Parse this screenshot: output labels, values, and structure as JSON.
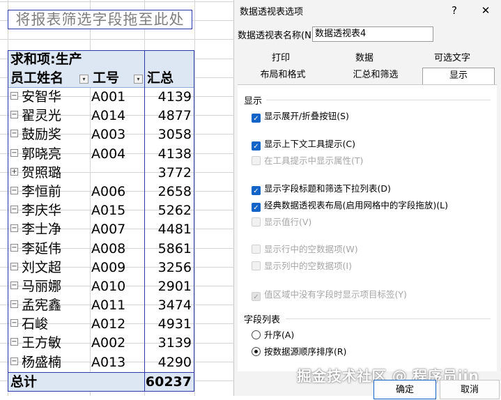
{
  "sheet": {
    "drop_hint": "将报表筛选字段拖至此处",
    "pivot": {
      "title": "求和项:生产",
      "header_name": "员工姓名",
      "header_id": "工号",
      "header_sum": "汇总",
      "filter_glyph": "▾",
      "expand_glyph": "⊞",
      "collapse_glyph": "⊟",
      "rows": [
        {
          "name": "安智华",
          "id": "A001",
          "value": "4139",
          "toggle": "−"
        },
        {
          "name": "翟灵光",
          "id": "A014",
          "value": "4877",
          "toggle": "−"
        },
        {
          "name": "鼓励奖",
          "id": "A003",
          "value": "3058",
          "toggle": "−"
        },
        {
          "name": "郭晓亮",
          "id": "A004",
          "value": "4138",
          "toggle": "−"
        },
        {
          "name": "贺照璐",
          "id": "",
          "value": "3772",
          "toggle": "+"
        },
        {
          "name": "李恒前",
          "id": "A006",
          "value": "2658",
          "toggle": "−"
        },
        {
          "name": "李庆华",
          "id": "A015",
          "value": "5262",
          "toggle": "−"
        },
        {
          "name": "李士净",
          "id": "A007",
          "value": "4481",
          "toggle": "−"
        },
        {
          "name": "李延伟",
          "id": "A008",
          "value": "5861",
          "toggle": "−"
        },
        {
          "name": "刘文超",
          "id": "A009",
          "value": "3256",
          "toggle": "−"
        },
        {
          "name": "马丽娜",
          "id": "A010",
          "value": "2901",
          "toggle": "−"
        },
        {
          "name": "孟宪鑫",
          "id": "A011",
          "value": "3474",
          "toggle": "−"
        },
        {
          "name": "石峻",
          "id": "A012",
          "value": "4931",
          "toggle": "−"
        },
        {
          "name": "王方敏",
          "id": "A002",
          "value": "3139",
          "toggle": "−"
        },
        {
          "name": "杨盛楠",
          "id": "A013",
          "value": "4290",
          "toggle": "−"
        }
      ],
      "total_label": "总计",
      "total_value": "60237"
    }
  },
  "dialog": {
    "title": "数据透视表选项",
    "help": "?",
    "close": "✕",
    "name_label": "数据透视表名称(N):",
    "name_value": "数据透视表4",
    "tabs_row1": [
      "打印",
      "数据",
      "可选文字"
    ],
    "tabs_row2": [
      "布局和格式",
      "汇总和筛选",
      "显示"
    ],
    "active_tab": "显示",
    "section_display": "显示",
    "options": [
      {
        "label": "显示展开/折叠按钮(S)",
        "checked": true,
        "enabled": true
      },
      {
        "label": "显示上下文工具提示(C)",
        "checked": true,
        "enabled": true
      },
      {
        "label": "在工具提示中显示属性(T)",
        "checked": false,
        "enabled": false
      },
      {
        "label": "显示字段标题和筛选下拉列表(D)",
        "checked": true,
        "enabled": true
      },
      {
        "label": "经典数据透视表布局(启用网格中的字段拖放)(L)",
        "checked": true,
        "enabled": true
      },
      {
        "label": "显示值行(V)",
        "checked": false,
        "enabled": false
      },
      {
        "label": "显示行中的空数据项(W)",
        "checked": false,
        "enabled": false
      },
      {
        "label": "显示列中的空数据项(I)",
        "checked": false,
        "enabled": false
      },
      {
        "label": "值区域中没有字段时显示项目标签(Y)",
        "checked": true,
        "enabled": false
      }
    ],
    "check_glyph": "✓",
    "section_field_list": "字段列表",
    "radios": [
      {
        "label": "升序(A)",
        "selected": false
      },
      {
        "label": "按数据源顺序排序(R)",
        "selected": true
      }
    ],
    "watermark": "掘金技术社区 @ 程序员jin",
    "ok": "确定",
    "cancel": "取消"
  }
}
